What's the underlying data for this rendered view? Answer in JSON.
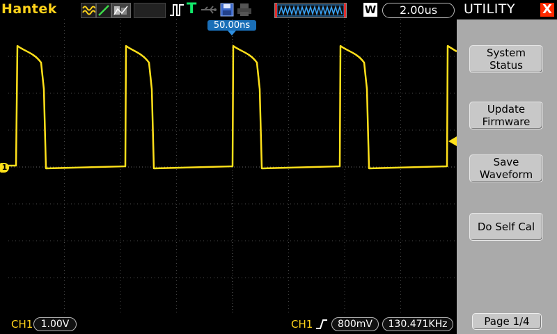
{
  "brand": "Hantek",
  "trigger_status": "T",
  "timebase": "2.00us",
  "window_indicator": "W",
  "trigger_position": "50.00ns",
  "channel_marker": "1",
  "sidebar": {
    "title": "UTILITY",
    "close": "X",
    "buttons": [
      {
        "label": "System\nStatus"
      },
      {
        "label": "Update\nFirmware"
      },
      {
        "label": "Save\nWaveform"
      },
      {
        "label": "Do Self Cal"
      }
    ],
    "page": "Page 1/4"
  },
  "status": {
    "ch1_label": "CH1",
    "ch1_scale": "1.00V",
    "trigger_source": "CH1",
    "trigger_level": "800mV",
    "frequency": "130.471KHz"
  },
  "colors": {
    "trace": "#ffe01a",
    "accent": "#ffd21a",
    "trigger_marker": "#2f8fe0",
    "close": "#ff2a00"
  },
  "icons": [
    "wave-mode-icon",
    "line-mode-icon",
    "persist-icon",
    "usb-icon",
    "save-icon",
    "print-icon",
    "rising-edge-icon"
  ]
}
